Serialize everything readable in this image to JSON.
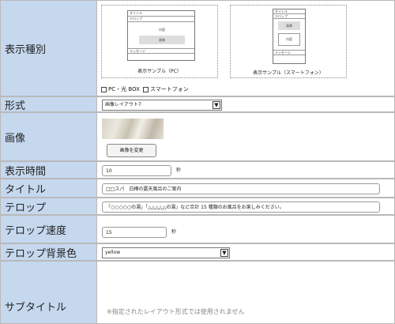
{
  "rows": {
    "display_type": {
      "label": "表示種別",
      "samples": {
        "pc": {
          "caption": "表示サンプル（PC）",
          "title_bar": "タイトル",
          "telop_bar": "テロップ",
          "content": "内容",
          "image": "画像",
          "message": "メッセージ"
        },
        "sp": {
          "caption": "表示サンプル（スマートフォン）",
          "title_bar": "タイトル",
          "telop_bar": "テロップ",
          "image": "画像",
          "content": "内容",
          "message": "メッセージ"
        }
      },
      "checkboxes": [
        {
          "label": "PC・光 BOX",
          "checked": false
        },
        {
          "label": "スマートフォン",
          "checked": false
        }
      ]
    },
    "format": {
      "label": "形式",
      "value": "画像レイアウト7"
    },
    "image": {
      "label": "画像",
      "change_button": "画像を変更"
    },
    "display_time": {
      "label": "表示時間",
      "value": "10",
      "unit": "秒"
    },
    "title": {
      "label": "タイトル",
      "value": "□□スパ　白樺の露天風呂のご案内"
    },
    "telop": {
      "label": "テロップ",
      "value": "「○○○○○の湯」「△△△△△の湯」など合計 15 種類のお風呂をお楽しみください。"
    },
    "telop_speed": {
      "label": "テロップ速度",
      "value": "15",
      "unit": "秒"
    },
    "telop_bg": {
      "label": "テロップ背景色",
      "value": "yellow"
    },
    "subtitle": {
      "label": "サブタイトル",
      "note": "※指定されたレイアウト形式では使用されません"
    }
  },
  "colors": {
    "label_bg": "#c5d8ee",
    "border": "#b9b9b9",
    "note": "#888888"
  }
}
